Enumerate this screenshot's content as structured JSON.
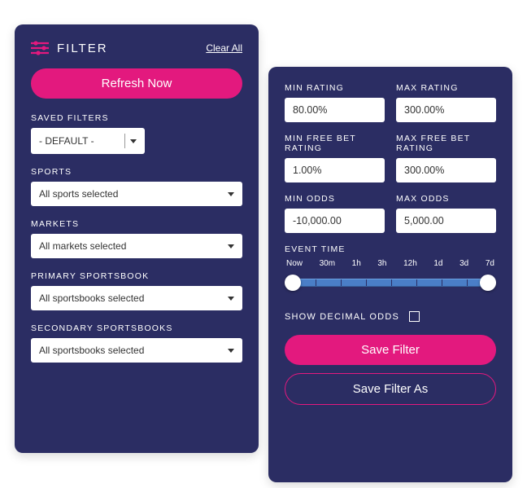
{
  "leftPanel": {
    "title": "FILTER",
    "clearAll": "Clear All",
    "refresh": "Refresh Now",
    "savedFilters": {
      "label": "SAVED FILTERS",
      "value": "- DEFAULT -"
    },
    "sports": {
      "label": "SPORTS",
      "value": "All sports selected"
    },
    "markets": {
      "label": "MARKETS",
      "value": "All markets selected"
    },
    "primarySportsbook": {
      "label": "PRIMARY SPORTSBOOK",
      "value": "All sportsbooks selected"
    },
    "secondarySportsbooks": {
      "label": "SECONDARY SPORTSBOOKS",
      "value": "All sportsbooks selected"
    }
  },
  "rightPanel": {
    "minRating": {
      "label": "MIN RATING",
      "value": "80.00%"
    },
    "maxRating": {
      "label": "MAX RATING",
      "value": "300.00%"
    },
    "minFreeBetRating": {
      "label": "MIN FREE BET RATING",
      "value": "1.00%"
    },
    "maxFreeBetRating": {
      "label": "MAX FREE BET RATING",
      "value": "300.00%"
    },
    "minOdds": {
      "label": "MIN ODDS",
      "value": "-10,000.00"
    },
    "maxOdds": {
      "label": "MAX ODDS",
      "value": "5,000.00"
    },
    "eventTime": {
      "label": "EVENT TIME",
      "ticks": [
        "Now",
        "30m",
        "1h",
        "3h",
        "12h",
        "1d",
        "3d",
        "7d"
      ]
    },
    "showDecimalOdds": "SHOW DECIMAL ODDS",
    "saveFilter": "Save Filter",
    "saveFilterAs": "Save Filter As"
  }
}
